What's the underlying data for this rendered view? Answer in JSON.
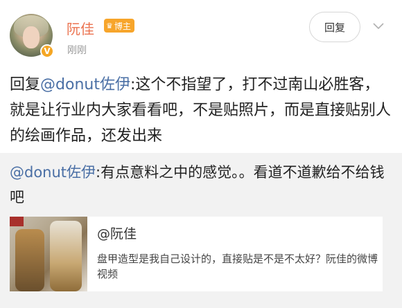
{
  "post": {
    "author": "阮佳",
    "badge": "博主",
    "time": "刚刚",
    "reply_label": "回复",
    "text_prefix": "回复",
    "mention": "@donut佐伊",
    "text_body": ":这个不指望了，打不过南山必胜客，就是让行业内大家看看吧，不是贴照片，而是直接贴别人的绘画作品，还发出来"
  },
  "quote": {
    "mention": "@donut佐伊",
    "text": ":有点意料之中的感觉。。看道不道歉给不给钱吧"
  },
  "card": {
    "title": "@阮佳",
    "description": "盘甲造型是我自己设计的，直接贴是不是不太好？阮佳的微博视频"
  },
  "icons": {
    "verified": "verified-v-icon",
    "crown": "crown-icon",
    "more": "chevron-down-icon"
  },
  "colors": {
    "username": "#eb7350",
    "mention": "#4a6fa5",
    "badge": "#f7a52b",
    "quote_bg": "#f2f2f2"
  }
}
